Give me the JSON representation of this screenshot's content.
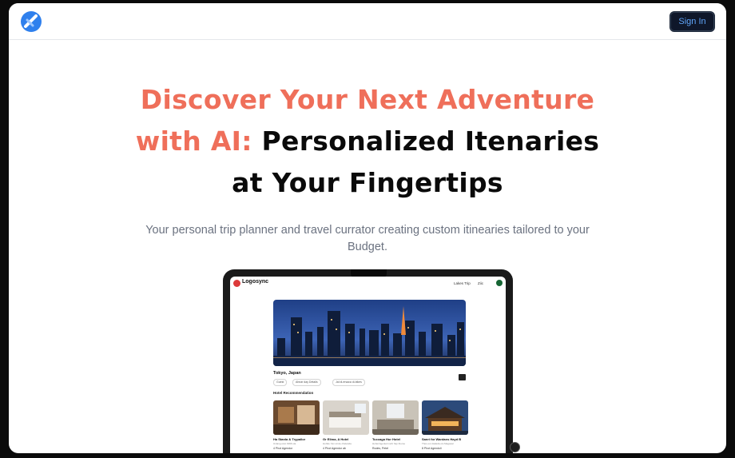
{
  "nav": {
    "logo_icon": "logo-icon",
    "signin_label": "Sign In",
    "colors": {
      "signin_bg": "#0f172a",
      "signin_text": "#60a5fa"
    }
  },
  "hero": {
    "line1_accent": "Discover Your Next Adventure",
    "line2_accent": "with AI:",
    "line2_rest": " Personalized Itenaries",
    "line3": "at Your Fingertips",
    "subtitle_line1": "Your personal trip planner and travel currator creating custom itinearies tailored to your",
    "subtitle_line2": "Budget.",
    "colors": {
      "accent": "#ef6f5a",
      "heading": "#0a0a0a",
      "subtitle": "#6b7280"
    }
  },
  "preview": {
    "brand": "Logosync",
    "nav_link1": "Lakes Trip",
    "nav_link2": "Ziic",
    "trip_title": "Tokyo, Japan",
    "chip1": "Guest",
    "chip2": "Ahnar day Details",
    "chip3": "Jal di-ersaca di-bikes",
    "section_title": "Hotel Recommendation",
    "hotels": [
      {
        "name": "Ha Stanla & Trypalior",
        "desc": "Unlang ozet 1996 sta",
        "meta": "4 Phot Agendor"
      },
      {
        "name": "Gr Elima, A Hotel",
        "desc": "Hohde Yan sit de chelanda",
        "meta": "4 Phot Agendor ab"
      },
      {
        "name": "Tuccaga Hur Hotel",
        "desc": "Hohel Agentel mehi hap theme",
        "meta": "Rodes, Petel"
      },
      {
        "name": "Sanri for Wardans Hayd B",
        "desc": "Thos our dadeda ois Magasar",
        "meta": "8 Phot Agendoli"
      }
    ]
  }
}
